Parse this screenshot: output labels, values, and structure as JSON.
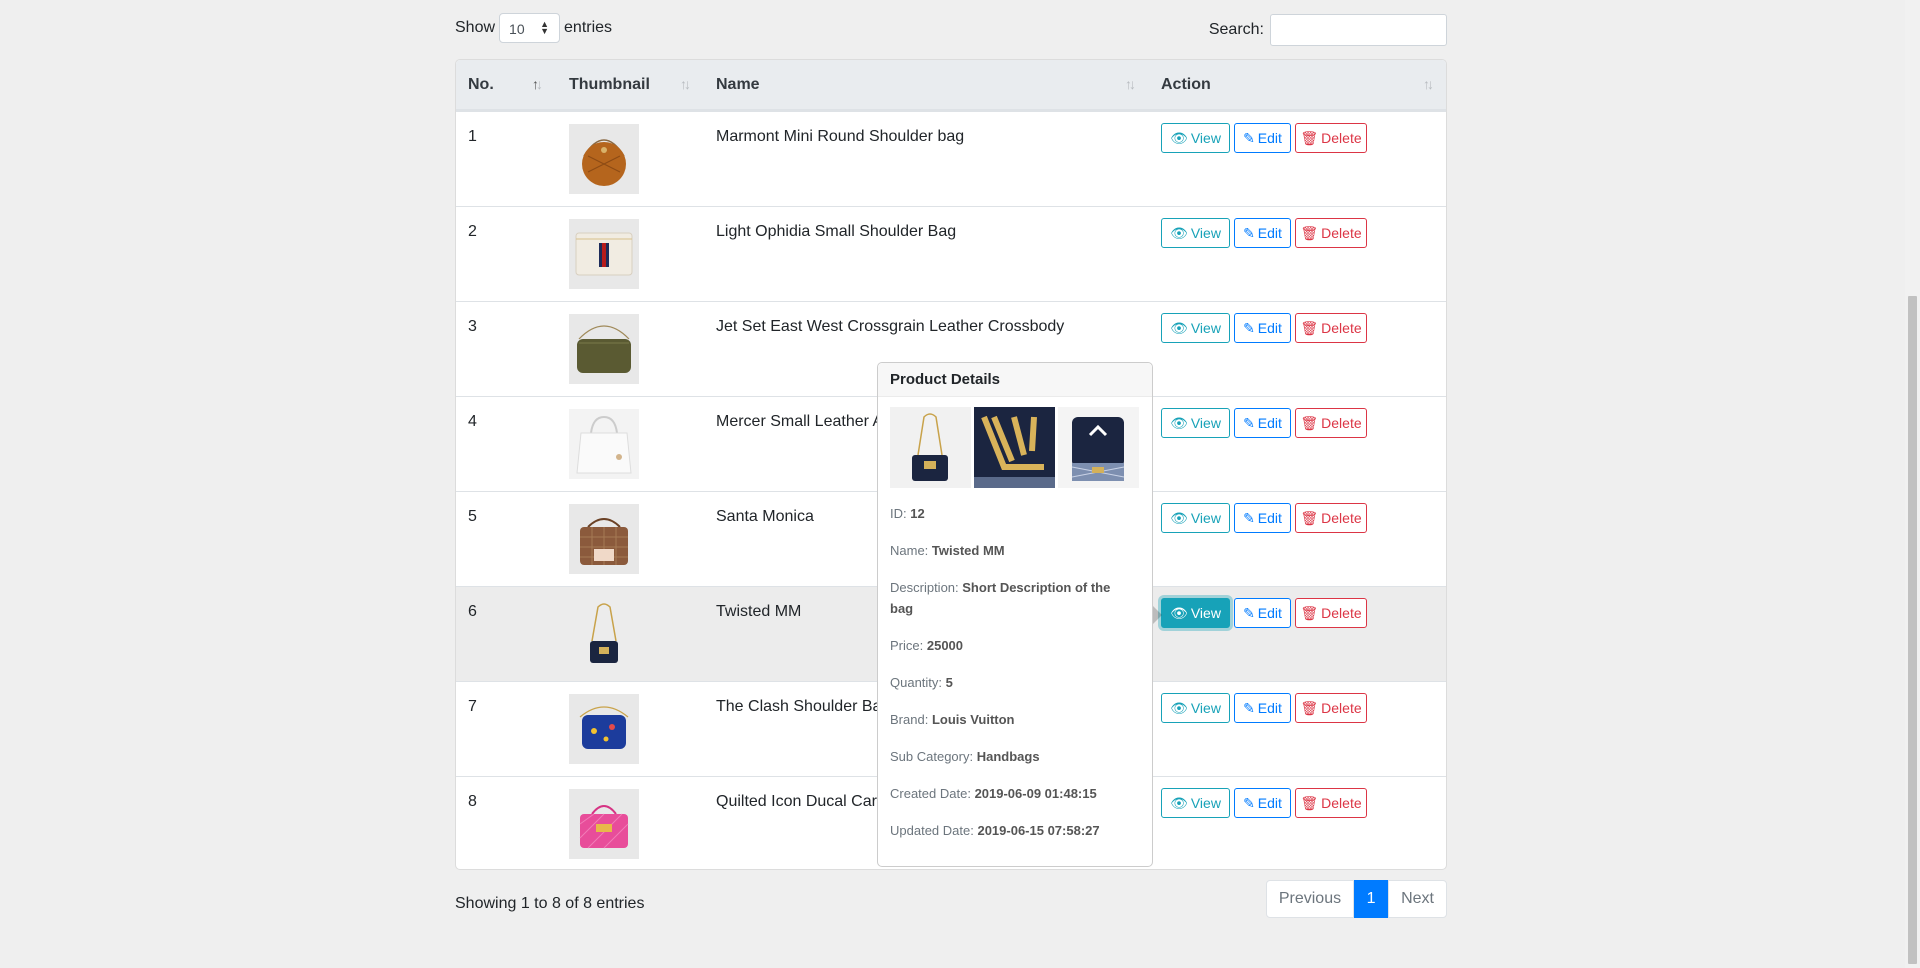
{
  "controls": {
    "show_label": "Show",
    "entries_value": "10",
    "entries_label": "entries",
    "search_label": "Search:",
    "search_value": ""
  },
  "table": {
    "headers": {
      "no": "No.",
      "thumbnail": "Thumbnail",
      "name": "Name",
      "action": "Action"
    },
    "rows": [
      {
        "no": "1",
        "name": "Marmont Mini Round Shoulder bag"
      },
      {
        "no": "2",
        "name": "Light Ophidia Small Shoulder Bag"
      },
      {
        "no": "3",
        "name": "Jet Set East West Crossgrain Leather Crossbody"
      },
      {
        "no": "4",
        "name": "Mercer Small Leather A"
      },
      {
        "no": "5",
        "name": "Santa Monica"
      },
      {
        "no": "6",
        "name": "Twisted MM"
      },
      {
        "no": "7",
        "name": "The Clash Shoulder Bag"
      },
      {
        "no": "8",
        "name": "Quilted Icon Ducal Carr"
      }
    ],
    "actions": {
      "view": "View",
      "edit": "Edit",
      "delete": "Delete"
    }
  },
  "footer": {
    "info": "Showing 1 to 8 of 8 entries",
    "prev": "Previous",
    "page": "1",
    "next": "Next"
  },
  "popover": {
    "title": "Product Details",
    "id_label": "ID:",
    "id": "12",
    "name_label": "Name:",
    "name": "Twisted MM",
    "desc_label": "Description:",
    "desc": "Short Description of the bag",
    "price_label": "Price:",
    "price": "25000",
    "qty_label": "Quantity:",
    "qty": "5",
    "brand_label": "Brand:",
    "brand": "Louis Vuitton",
    "subcat_label": "Sub Category:",
    "subcat": "Handbags",
    "created_label": "Created Date:",
    "created": "2019-06-09 01:48:15",
    "updated_label": "Updated Date:",
    "updated": "2019-06-15 07:58:27"
  },
  "colors": {
    "info": "#17a2b8",
    "primary": "#007bff",
    "danger": "#dc3545"
  }
}
